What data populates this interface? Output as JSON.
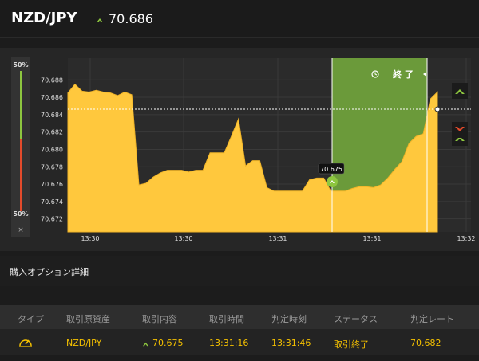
{
  "header": {
    "pair": "NZD/JPY",
    "rate": "70.686",
    "rate_direction_icon": "up-arrow-icon",
    "accent_up": "#8dc63f",
    "accent_down": "#e24a2b"
  },
  "gauge": {
    "top_label": "50%",
    "bottom_label": "50%",
    "close_label": "×"
  },
  "chart": {
    "y_ticks": [
      "70.688",
      "70.686",
      "70.684",
      "70.682",
      "70.680",
      "70.678",
      "70.676",
      "70.674",
      "70.672"
    ],
    "x_ticks": [
      "13:30",
      "13:30",
      "13:31",
      "13:31",
      "13:32"
    ],
    "expiry_label": "終 了",
    "entry_label": "70.675",
    "area_color": "#ffc83d",
    "window_color": "#6b9a3a",
    "buttons": {
      "up_icon": "up-chevron-icon",
      "down_icon": "down-chevron-icon"
    }
  },
  "chart_data": {
    "type": "area",
    "title": "",
    "ylim": [
      70.6705,
      70.6905
    ],
    "y_ticks": [
      70.672,
      70.674,
      70.676,
      70.678,
      70.68,
      70.682,
      70.684,
      70.686,
      70.688
    ],
    "x_ticks": [
      "13:30",
      "13:30",
      "13:31",
      "13:31",
      "13:32"
    ],
    "series": [
      {
        "values": [
          70.6865,
          70.6875,
          70.6867,
          70.6866,
          70.6868,
          70.6866,
          70.6865,
          70.6862,
          70.6866,
          70.6863,
          70.6759,
          70.6761,
          70.6768,
          70.6773,
          70.6776,
          70.6776,
          70.6776,
          70.6774,
          70.6776,
          70.6776,
          70.6796,
          70.6796,
          70.6796,
          70.6815,
          70.6835,
          70.6781,
          70.6787,
          70.6787,
          70.6756,
          70.6752,
          70.6752,
          70.6752,
          70.6752,
          70.6752,
          70.6765,
          70.6767,
          70.6767,
          70.6752,
          70.6752,
          70.6752,
          70.6755,
          70.6757,
          70.6757,
          70.6756,
          70.6759,
          70.6767,
          70.6777,
          70.6786,
          70.6807,
          70.6815,
          70.6818,
          70.6858,
          70.6866
        ]
      }
    ],
    "annotations": {
      "current_rate": 70.686,
      "entry_rate": 70.675,
      "expiry_label": "終 了"
    }
  },
  "section": {
    "title": "購入オプション詳細"
  },
  "table": {
    "headers": [
      "タイプ",
      "取引原資産",
      "取引内容",
      "取引時間",
      "判定時刻",
      "ステータス",
      "判定レート"
    ],
    "row": {
      "type_icon": "gauge-icon",
      "asset": "NZD/JPY",
      "content": "70.675",
      "trade_time": "13:31:16",
      "judge_time": "13:31:46",
      "status": "取引終了",
      "rate": "70.682"
    }
  }
}
